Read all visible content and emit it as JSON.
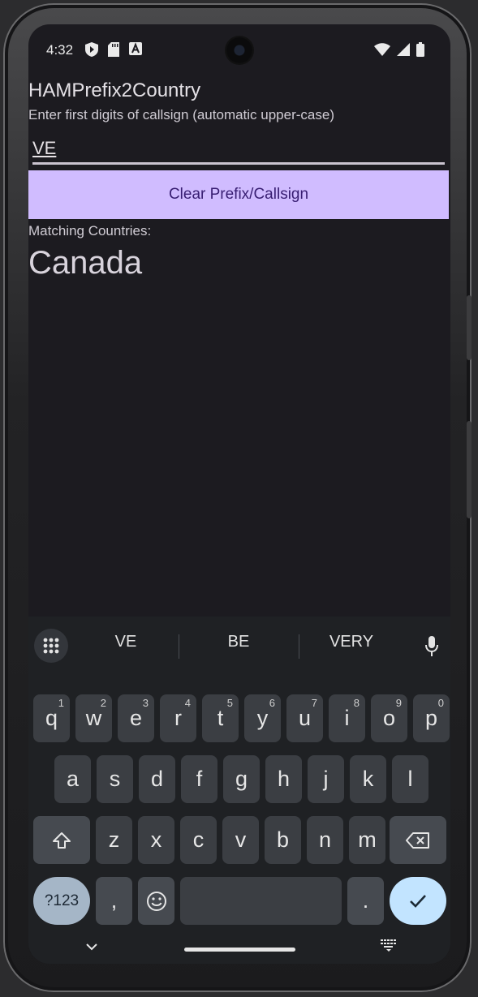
{
  "status_bar": {
    "time": "4:32",
    "left_icons": [
      "play-protect-icon",
      "sd-card-icon",
      "a-notification-icon"
    ],
    "right_icons": [
      "wifi-icon",
      "cell-signal-icon",
      "battery-icon"
    ]
  },
  "app": {
    "title": "HAMPrefix2Country",
    "subtitle": "Enter first digits of callsign (automatic upper-case)",
    "input_value": "VE",
    "clear_button_label": "Clear Prefix/Callsign",
    "matching_label": "Matching Countries:",
    "countries": [
      "Canada"
    ]
  },
  "keyboard": {
    "suggestions": [
      "VE",
      "BE",
      "VERY"
    ],
    "rows": [
      [
        {
          "k": "q",
          "h": "1"
        },
        {
          "k": "w",
          "h": "2"
        },
        {
          "k": "e",
          "h": "3"
        },
        {
          "k": "r",
          "h": "4"
        },
        {
          "k": "t",
          "h": "5"
        },
        {
          "k": "y",
          "h": "6"
        },
        {
          "k": "u",
          "h": "7"
        },
        {
          "k": "i",
          "h": "8"
        },
        {
          "k": "o",
          "h": "9"
        },
        {
          "k": "p",
          "h": "0"
        }
      ],
      [
        {
          "k": "a"
        },
        {
          "k": "s"
        },
        {
          "k": "d"
        },
        {
          "k": "f"
        },
        {
          "k": "g"
        },
        {
          "k": "h"
        },
        {
          "k": "j"
        },
        {
          "k": "k"
        },
        {
          "k": "l"
        }
      ],
      [
        {
          "k": "z"
        },
        {
          "k": "x"
        },
        {
          "k": "c"
        },
        {
          "k": "v"
        },
        {
          "k": "b"
        },
        {
          "k": "n"
        },
        {
          "k": "m"
        }
      ]
    ],
    "symbols_label": "?123",
    "comma_label": ",",
    "period_label": ".",
    "colors": {
      "accent": "#d0bcff",
      "enter": "#c2e4ff",
      "symbols": "#a5b6c7"
    }
  }
}
